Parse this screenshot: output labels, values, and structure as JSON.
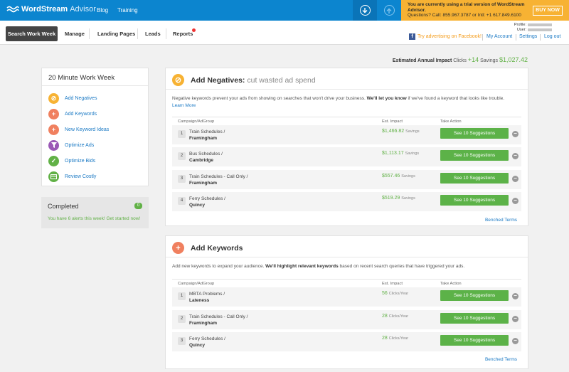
{
  "topbar": {
    "logo": "WordStream",
    "logo_sub": "Advisor",
    "nav": [
      "Blog",
      "Training"
    ],
    "icons": [
      "download-icon",
      "upload-icon"
    ],
    "promo_line1": "You are currently using a trial version of WordStream Advisor.",
    "promo_line2": "Questions? Call: 855.967.3787 or Intl: +1 617.849.6100",
    "buy_now": "BUY NOW"
  },
  "subbar": {
    "tabs": [
      "Search Work Week",
      "Manage",
      "Landing Pages",
      "Leads",
      "Reports"
    ],
    "profile_label": "Profile:",
    "user_label": "User:",
    "facebook_link": "Try advertising on Facebook!",
    "my_account": "My Account",
    "settings": "Settings",
    "logout": "Log out"
  },
  "impact": {
    "label": "Estimated Annual Impact",
    "clicks_label": "Clicks",
    "clicks": "+14",
    "savings_label": "Savings",
    "savings": "$1,027.42"
  },
  "sidebar": {
    "title": "20 Minute Work Week",
    "items": [
      {
        "label": "Add Negatives",
        "icon": "no-entry-icon",
        "color": "#f7b233"
      },
      {
        "label": "Add Keywords",
        "icon": "plus-icon",
        "color": "#f0805f"
      },
      {
        "label": "New Keyword Ideas",
        "icon": "plus-icon",
        "color": "#f0805f"
      },
      {
        "label": "Optimize Ads",
        "icon": "funnel-icon",
        "color": "#9b59b6"
      },
      {
        "label": "Optimize Bids",
        "icon": "check-icon",
        "color": "#61b146"
      },
      {
        "label": "Review Costly",
        "icon": "card-icon",
        "color": "#61b146"
      }
    ],
    "completed_title": "Completed",
    "completed_count": "0",
    "completed_text": "You have 6 alerts this week! Get started now!"
  },
  "negatives": {
    "title": "Add Negatives:",
    "subtitle": "cut wasted ad spend",
    "desc_1": "Negative keywords prevent your ads from showing on searches that won't drive your business.",
    "desc_bold": "We'll let you know",
    "desc_2": "if we've found a keyword that looks like trouble.",
    "learn_more": "Learn More",
    "col_campaign": "Campaign/AdGroup",
    "col_impact": "Est. Impact",
    "col_action": "Take Action",
    "rows": [
      {
        "num": "1",
        "campaign": "Train Schedules /",
        "adgroup": "Framingham",
        "value": "$1,466.82",
        "unit": "Savings",
        "action": "See 10 Suggestions"
      },
      {
        "num": "2",
        "campaign": "Bus Schedules /",
        "adgroup": "Cambridge",
        "value": "$1,113.17",
        "unit": "Savings",
        "action": "See 10 Suggestions"
      },
      {
        "num": "3",
        "campaign": "Train Schedules - Call Only /",
        "adgroup": "Framingham",
        "value": "$557.46",
        "unit": "Savings",
        "action": "See 10 Suggestions"
      },
      {
        "num": "4",
        "campaign": "Ferry Schedules /",
        "adgroup": "Quincy",
        "value": "$519.29",
        "unit": "Savings",
        "action": "See 10 Suggestions"
      }
    ],
    "benched": "Benched Terms"
  },
  "keywords": {
    "title": "Add Keywords",
    "desc_1": "Add new keywords to expand your audience.",
    "desc_bold": "We'll highlight relevant keywords",
    "desc_2": "based on recent search queries that have triggered your ads.",
    "col_campaign": "Campaign/AdGroup",
    "col_impact": "Est. Impact",
    "col_action": "Take Action",
    "rows": [
      {
        "num": "1",
        "campaign": "MBTA Problems /",
        "adgroup": "Lateness",
        "value": "56",
        "unit": "Clicks/Year",
        "action": "See 10 Suggestions"
      },
      {
        "num": "2",
        "campaign": "Train Schedules - Call Only /",
        "adgroup": "Framingham",
        "value": "28",
        "unit": "Clicks/Year",
        "action": "See 10 Suggestions"
      },
      {
        "num": "3",
        "campaign": "Ferry Schedules /",
        "adgroup": "Quincy",
        "value": "28",
        "unit": "Clicks/Year",
        "action": "See 10 Suggestions"
      }
    ],
    "benched": "Benched Terms"
  }
}
